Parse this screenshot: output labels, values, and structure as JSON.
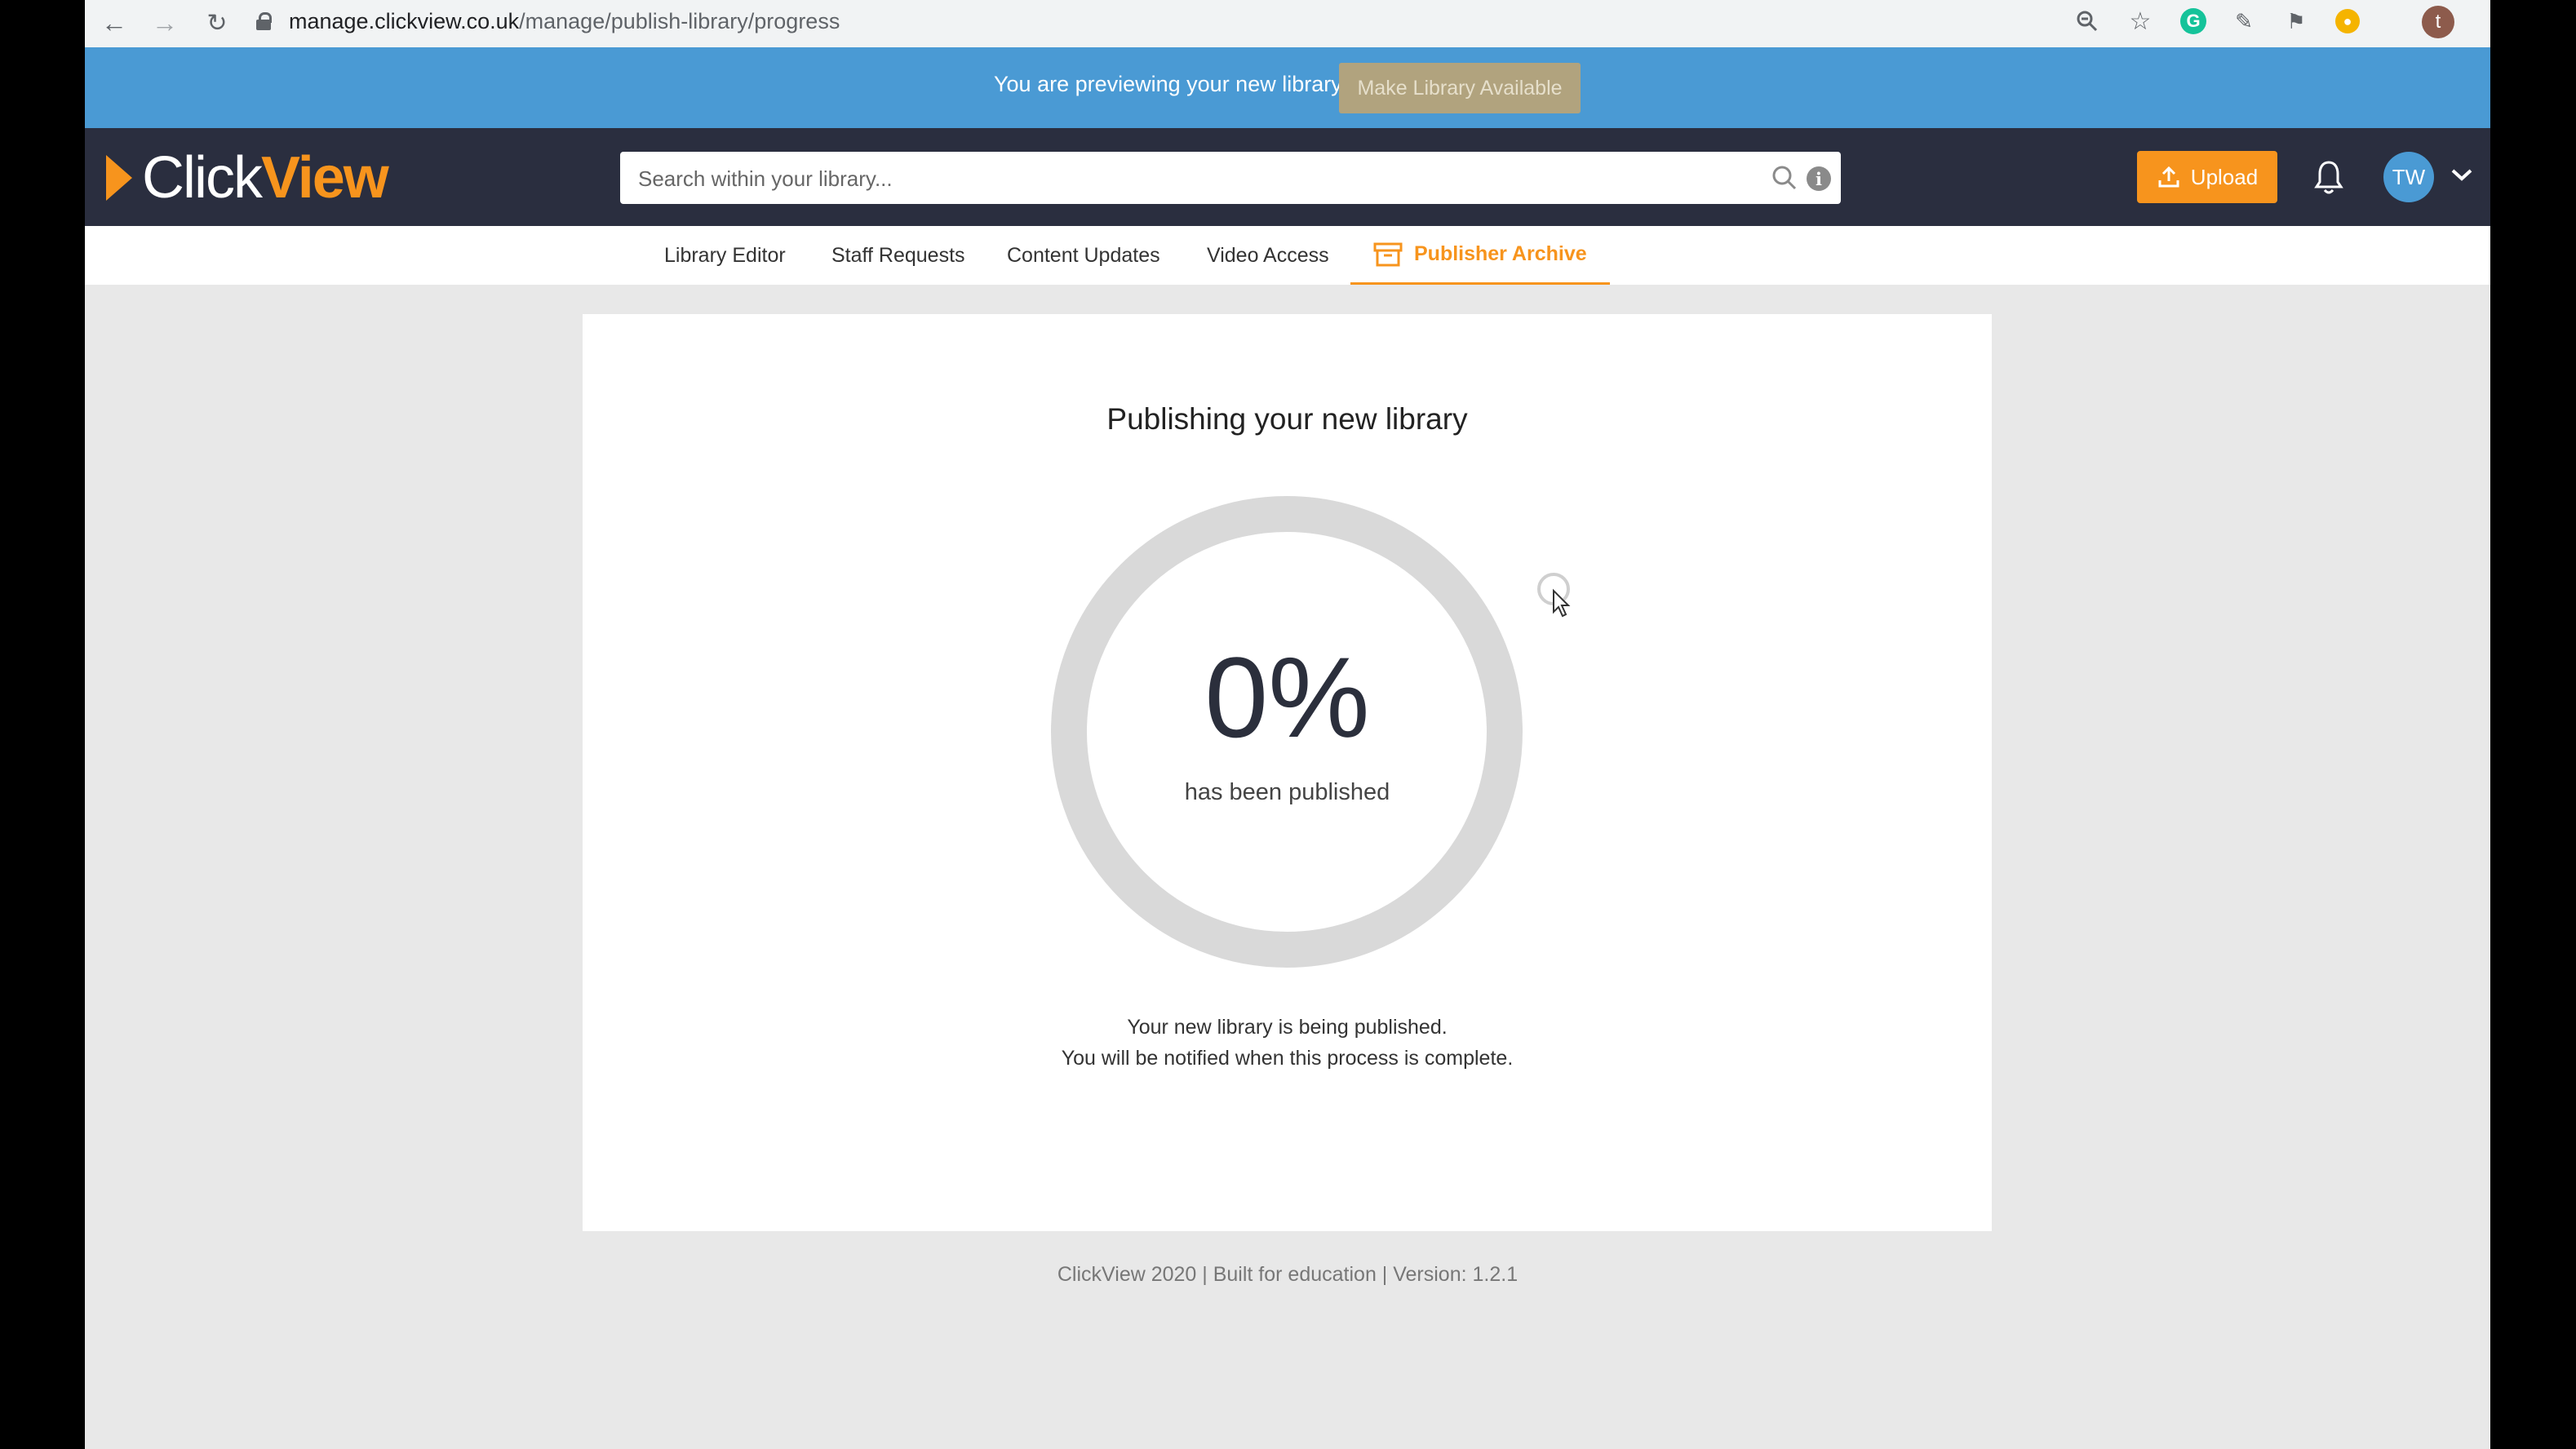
{
  "browser": {
    "url_host": "manage.clickview.co.uk",
    "url_path": "/manage/publish-library/progress",
    "profile_initial": "t"
  },
  "banner": {
    "text": "You are previewing your new library",
    "button_label": "Make Library Available"
  },
  "header": {
    "logo_part1": "Click",
    "logo_part2": "View",
    "search_placeholder": "Search within your library...",
    "upload_label": "Upload",
    "avatar_initials": "TW"
  },
  "tabs": [
    {
      "label": "Library Editor"
    },
    {
      "label": "Staff Requests"
    },
    {
      "label": "Content Updates"
    },
    {
      "label": "Video Access"
    },
    {
      "label": "Publisher Archive",
      "active": true
    }
  ],
  "main": {
    "title": "Publishing your new library",
    "progress_percent": 0,
    "progress_label": "0%",
    "progress_sub": "has been published",
    "message_line1": "Your new library is being published.",
    "message_line2": "You will be notified when this process is complete."
  },
  "footer": {
    "text": "ClickView 2020 | Built for education | Version: 1.2.1"
  },
  "colors": {
    "accent": "#f7941d",
    "banner": "#4a9ad4",
    "header": "#2a2e3f",
    "ring_track": "#d9d9d9"
  }
}
